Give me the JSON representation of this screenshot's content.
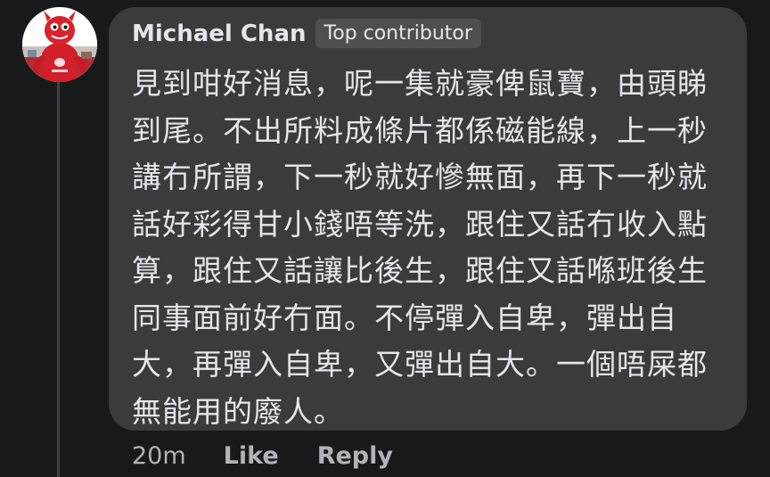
{
  "comment": {
    "author": "Michael Chan",
    "badge": "Top contributor",
    "lines": [
      "見到咁好消息，呢一集就豪俾鼠寶，由頭睇",
      "到尾。不出所料成條片都係磁能線，上一秒",
      "講冇所謂，下一秒就好慘無面，再下一秒就",
      "話好彩得甘小錢唔等洗，跟住又話冇收入點",
      "算，跟住又話讓比後生，跟住又話喺班後生",
      "同事面前好冇面。不停彈入自卑，彈出自",
      "大，再彈入自卑，又彈出自大。一個唔屎都",
      "無能用的廢人。"
    ]
  },
  "actions": {
    "time": "20m",
    "like": "Like",
    "reply": "Reply"
  },
  "colors": {
    "background": "#18191a",
    "bubble": "#3a3b3c",
    "text": "#e4e6eb",
    "secondary_text": "#b0b3b8",
    "badge_bg": "#4e4f50",
    "avatar_mascot": "#d21f2a"
  },
  "icons": {
    "avatar": "red-mascot-avatar-icon"
  }
}
